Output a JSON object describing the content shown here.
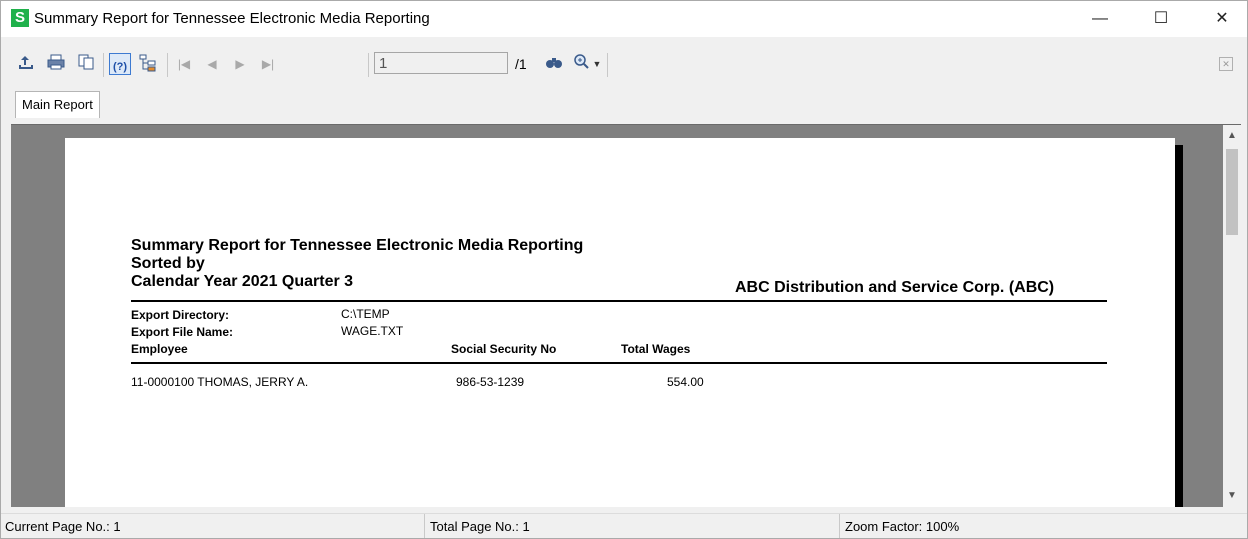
{
  "window": {
    "title": "Summary Report for Tennessee Electronic Media Reporting",
    "app_icon_letter": "S",
    "minimize": "—",
    "maximize": "☐",
    "close": "✕"
  },
  "toolbar": {
    "page_value": "1",
    "page_total": "/1",
    "icons": [
      "export-icon",
      "print-icon",
      "copy-icon",
      "help-icon",
      "group-tree-icon",
      "first-page-icon",
      "previous-page-icon",
      "next-page-icon",
      "last-page-icon",
      "search-icon",
      "zoom-icon"
    ]
  },
  "tabs": {
    "main": "Main Report"
  },
  "report": {
    "title_line1": "Summary Report for Tennessee Electronic Media Reporting",
    "title_line2": "Sorted by",
    "title_line3": "Calendar Year 2021 Quarter 3",
    "company": "ABC Distribution and Service Corp. (ABC)",
    "export_directory_label": "Export Directory:",
    "export_directory_value": "C:\\TEMP",
    "export_file_label": "Export File Name:",
    "export_file_value": "WAGE.TXT",
    "columns": {
      "employee": "Employee",
      "ssn": "Social Security No",
      "wages": "Total Wages"
    },
    "rows": [
      {
        "employee": "11-0000100  THOMAS, JERRY A.",
        "ssn": "986-53-1239",
        "wages": "554.00"
      }
    ]
  },
  "status": {
    "current_page": "Current Page No.: 1",
    "total_page": "Total Page No.: 1",
    "zoom": "Zoom Factor: 100%"
  }
}
